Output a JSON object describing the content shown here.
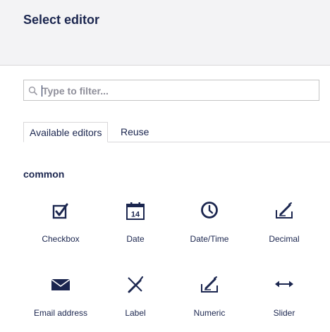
{
  "header": {
    "title": "Select editor"
  },
  "filter": {
    "placeholder": "Type to filter..."
  },
  "tabs": [
    {
      "label": "Available editors",
      "active": true
    },
    {
      "label": "Reuse",
      "active": false
    }
  ],
  "group": {
    "title": "common",
    "editors": [
      {
        "label": "Checkbox",
        "icon": "checkbox-icon"
      },
      {
        "label": "Date",
        "icon": "calendar-icon",
        "icon_text": "14"
      },
      {
        "label": "Date/Time",
        "icon": "clock-icon"
      },
      {
        "label": "Decimal",
        "icon": "edit-icon"
      },
      {
        "label": "Email address",
        "icon": "envelope-icon"
      },
      {
        "label": "Label",
        "icon": "pencil-cross-icon"
      },
      {
        "label": "Numeric",
        "icon": "edit-icon"
      },
      {
        "label": "Slider",
        "icon": "arrows-horizontal-icon"
      }
    ]
  },
  "colors": {
    "text": "#1b264f",
    "header_bg": "#f3f3f5",
    "border": "#d8d7d9",
    "placeholder": "#8f8f9a"
  }
}
